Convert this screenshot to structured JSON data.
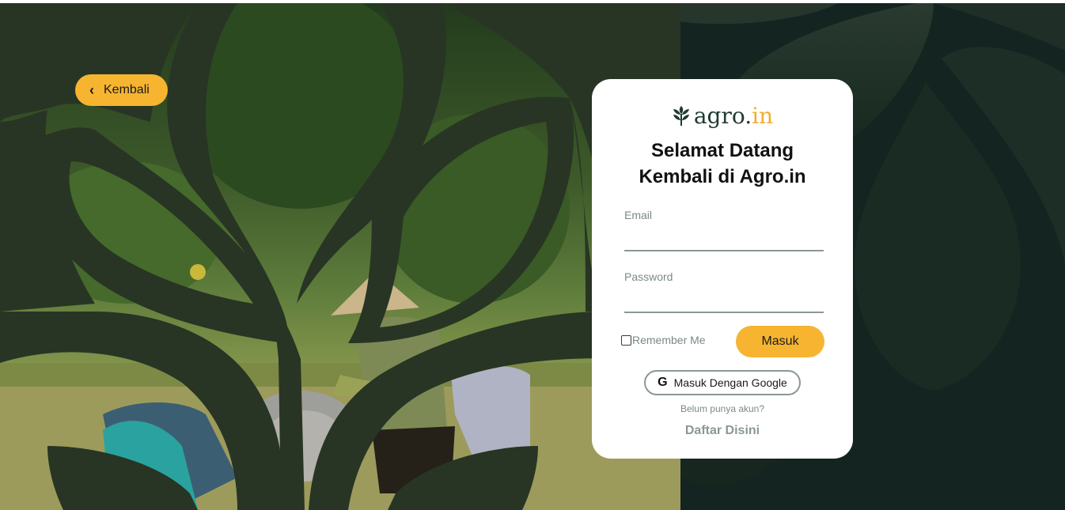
{
  "back_button": {
    "label": "Kembali",
    "icon": "chevron-left-icon"
  },
  "logo": {
    "part1": "agro.",
    "part2": "in",
    "icon": "leaf-icon"
  },
  "heading": {
    "line1": "Selamat Datang",
    "line2": "Kembali di Agro.in"
  },
  "form": {
    "email_label": "Email",
    "email_value": "",
    "password_label": "Password",
    "password_value": "",
    "remember_label": "Remember Me",
    "remember_checked": false,
    "submit_label": "Masuk",
    "google_label": "Masuk Dengan Google",
    "google_icon": "google-g-icon"
  },
  "footer": {
    "question": "Belum punya akun?",
    "register_link": "Daftar Disini"
  },
  "colors": {
    "accent": "#f6b431",
    "background": "#132421",
    "leaf_shape": "#283524",
    "brand_dark": "#1f3a33"
  }
}
